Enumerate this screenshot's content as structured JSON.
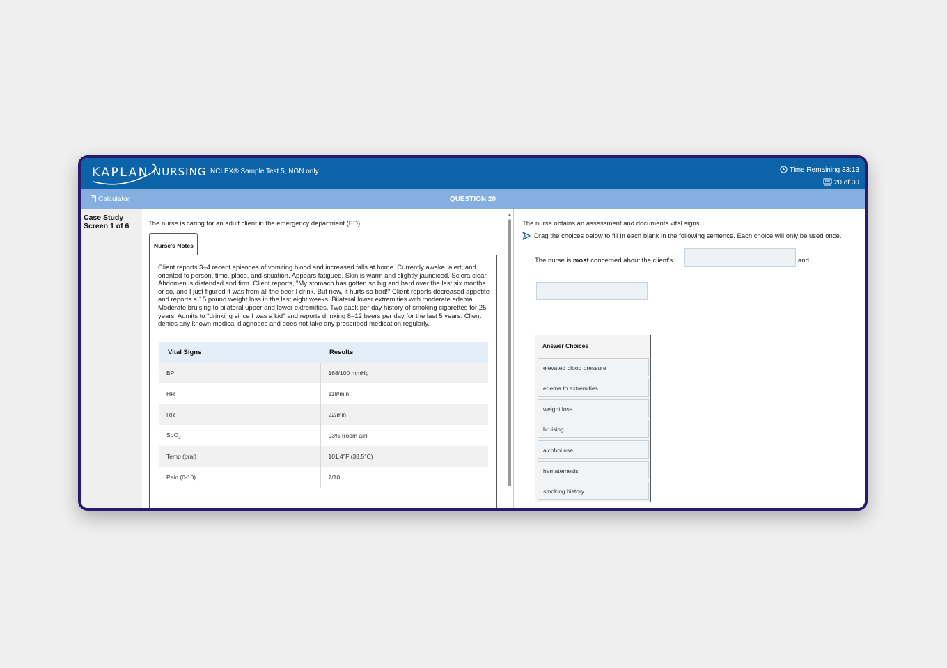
{
  "header": {
    "logo_kaplan": "KAPLAN",
    "logo_nursing": "NURSING",
    "test_name": "NCLEX® Sample Test 5, NGN only",
    "time_remaining": "Time Remaining 33:13",
    "question_count": "20 of 30"
  },
  "toolbar": {
    "calculator_label": "Calculator",
    "question_label": "QUESTION 20"
  },
  "sidebar": {
    "case_study": "Case Study",
    "screen": "Screen 1 of 6"
  },
  "left": {
    "intro": "The nurse is caring for an adult client in the emergency department (ED).",
    "tab_label": "Nurse's Notes",
    "notes": "Client reports 3–4 recent episodes of vomiting blood and increased falls at home. Currently awake, alert, and oriented to person, time, place, and situation. Appears fatigued. Skin is warm and slightly jaundiced. Sclera clear. Abdomen is distended and firm. Client reports, \"My stomach has gotten so big and hard over the last six months or so, and I just figured it was from all the beer I drink. But now, it hurts so bad!\" Client reports decreased appetite and reports a 15 pound weight loss in the last eight weeks. Bilateral lower extremities with moderate edema. Moderate bruising to bilateral upper and lower extremities. Two pack per day history of smoking cigarettes for 25 years. Admits to \"drinking since I was a kid\" and reports drinking 8–12 beers per day for the last 5 years. Client denies any known medical diagnoses and does not take any prescribed medication regularly.",
    "table": {
      "headers": [
        "Vital Signs",
        "Results"
      ],
      "rows": [
        {
          "sign": "BP",
          "result": "168/100 mmHg"
        },
        {
          "sign": "HR",
          "result": "118/min"
        },
        {
          "sign": "RR",
          "result": "22/min"
        },
        {
          "sign": "SpO",
          "sign_sub": "2",
          "result": "93% (room air)"
        },
        {
          "sign": "Temp (oral)",
          "result": "101.4°F (38.5°C)"
        },
        {
          "sign": "Pain (0-10)",
          "result": "7/10"
        }
      ]
    }
  },
  "right": {
    "intro": "The nurse obtains an assessment and documents vital signs.",
    "instruction": "Drag the choices below to fill in each blank in the following sentence. Each choice will only be used once.",
    "sentence_pre": "The nurse is ",
    "sentence_bold": "most",
    "sentence_post": " concerned about the client's",
    "sentence_and": "and",
    "sentence_end": ".",
    "choices_title": "Answer Choices",
    "choices": [
      "elevated blood pressure",
      "edema to extremities",
      "weight loss",
      "bruising",
      "alcohol use",
      "hematemesis",
      "smoking history"
    ]
  },
  "colors": {
    "header_bg": "#0d63a8",
    "subbar_bg": "#84afe0",
    "frame_border": "#2a1a6e",
    "table_header_bg": "#e3eef9"
  }
}
